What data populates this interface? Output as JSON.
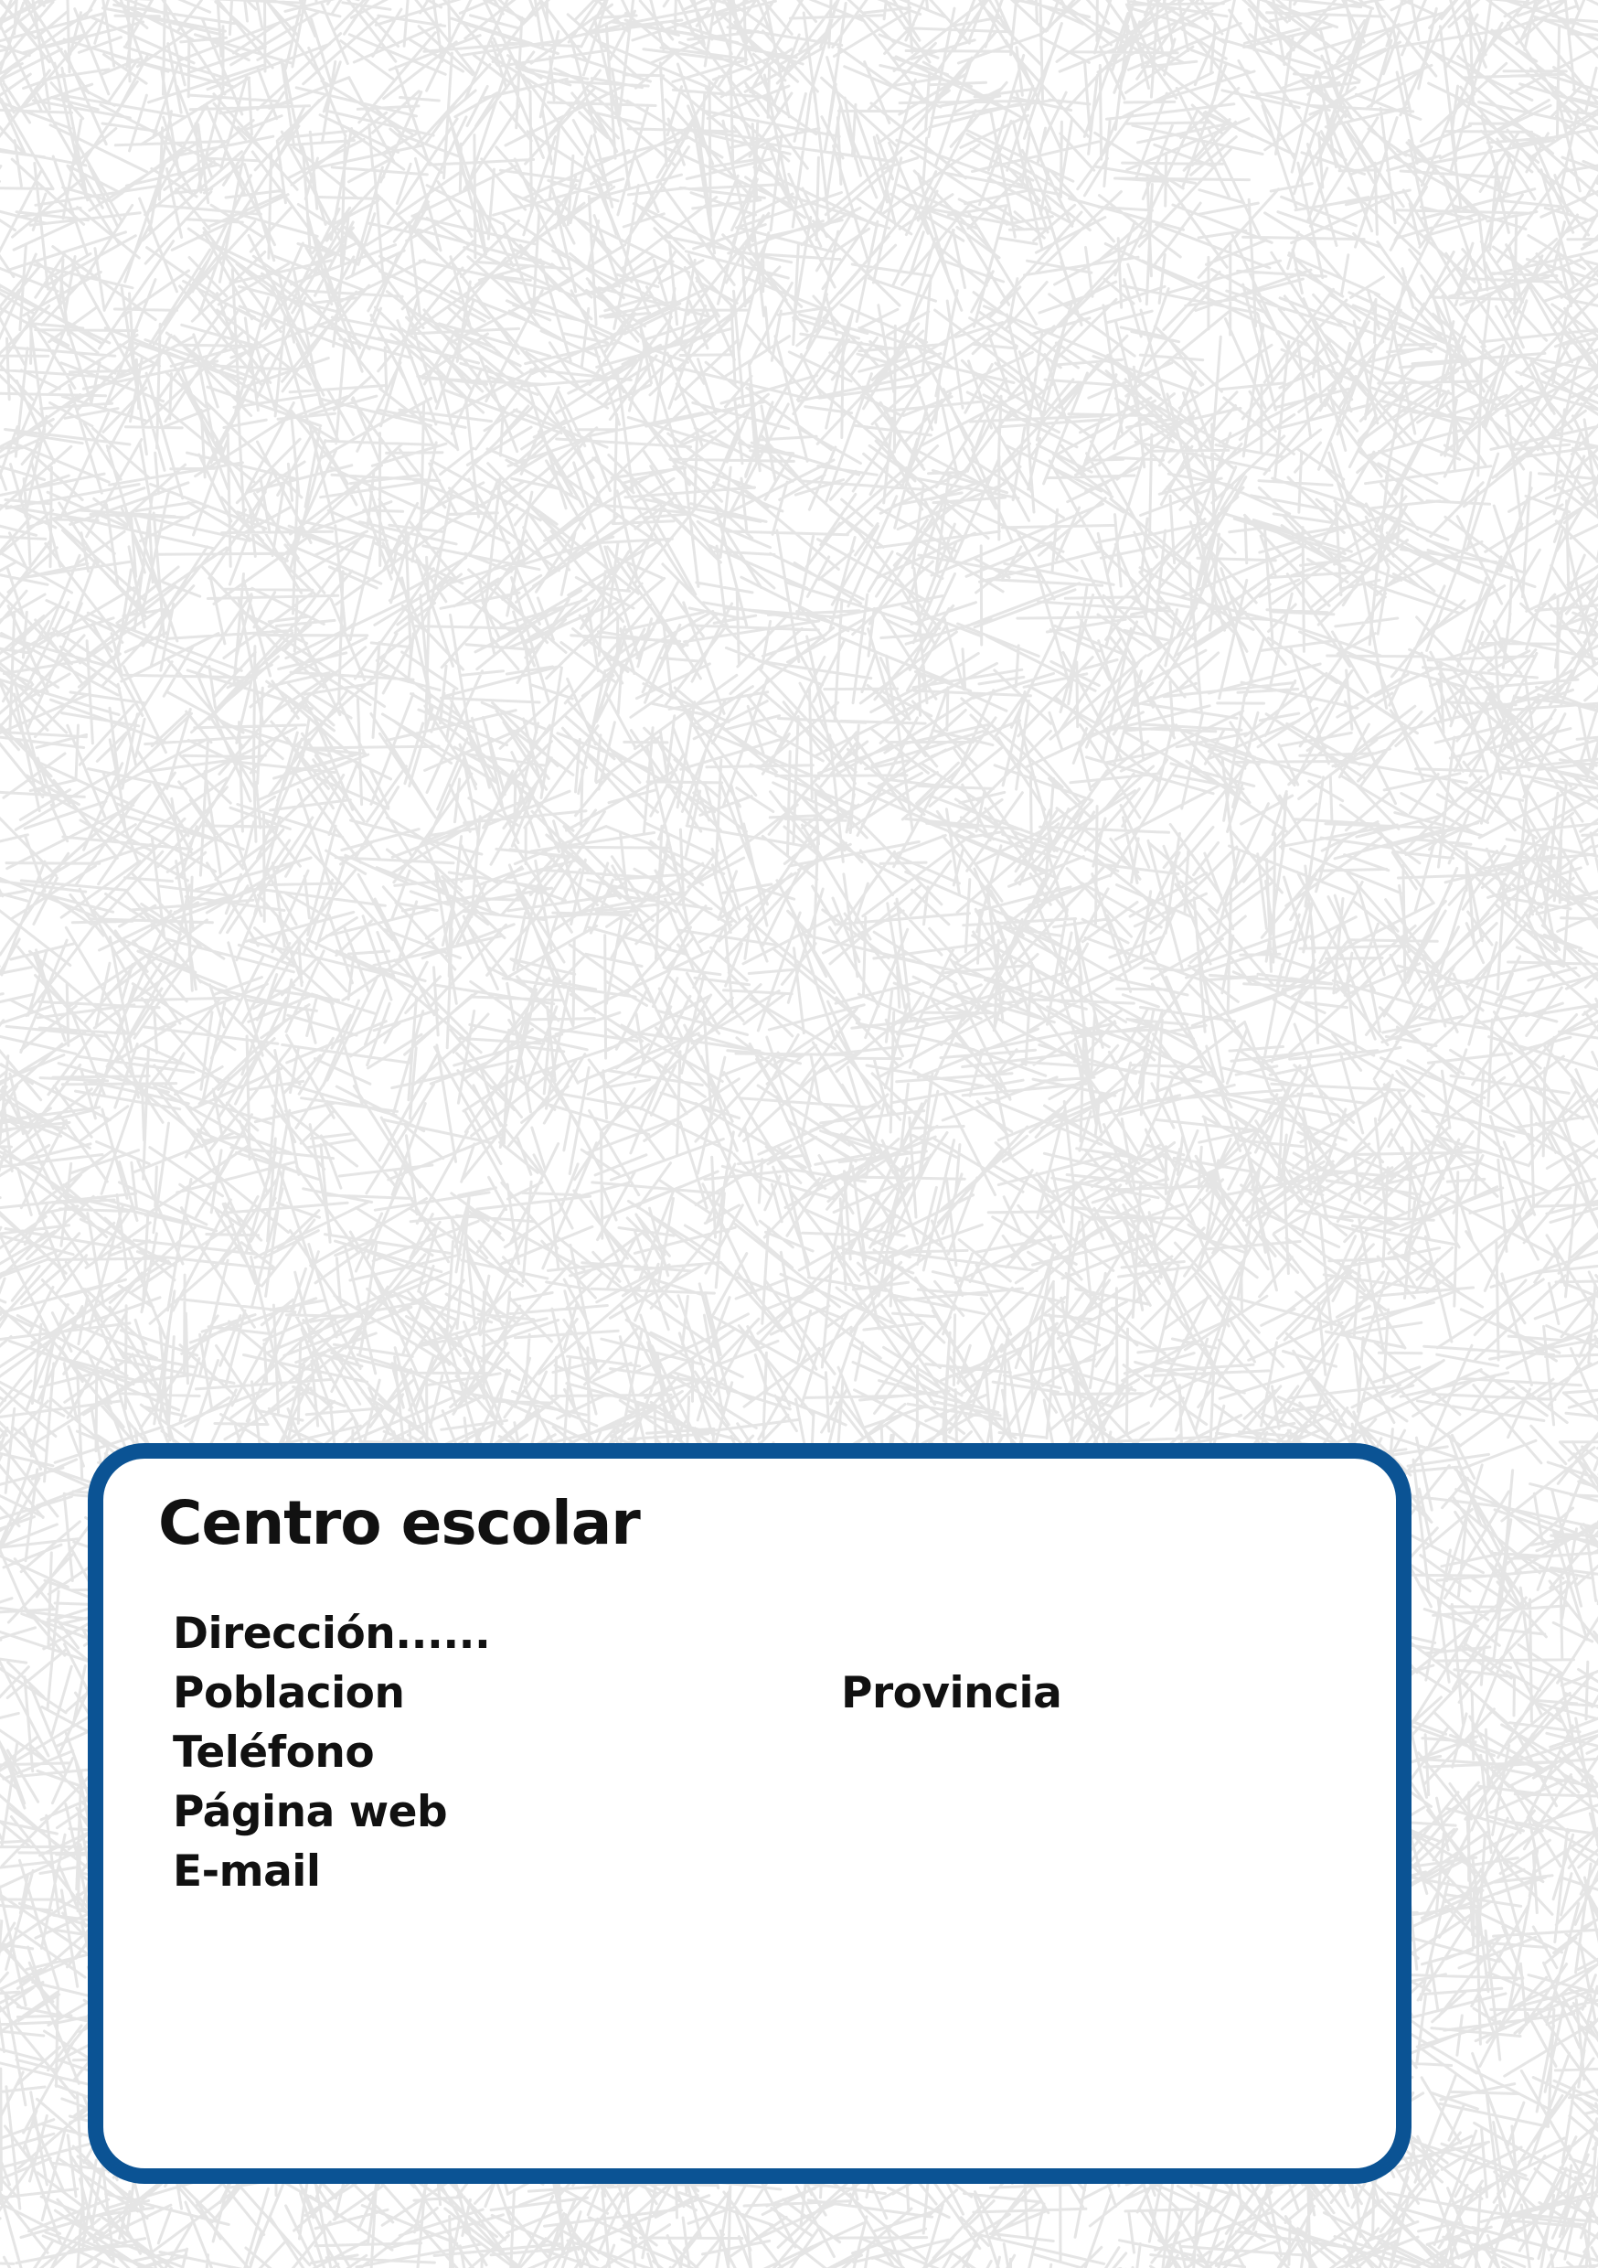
{
  "background": {
    "base_color": "#ffffff",
    "pattern_color": "#dcdcdc",
    "pattern": "random-crisscross-lines"
  },
  "card": {
    "border_color": "#0b5394",
    "title": "Centro escolar",
    "fields": {
      "direccion": "Dirección......",
      "poblacion": "Poblacion",
      "provincia": "Provincia",
      "telefono": "Teléfono",
      "pagina_web": "Página web",
      "email": "E-mail"
    }
  }
}
